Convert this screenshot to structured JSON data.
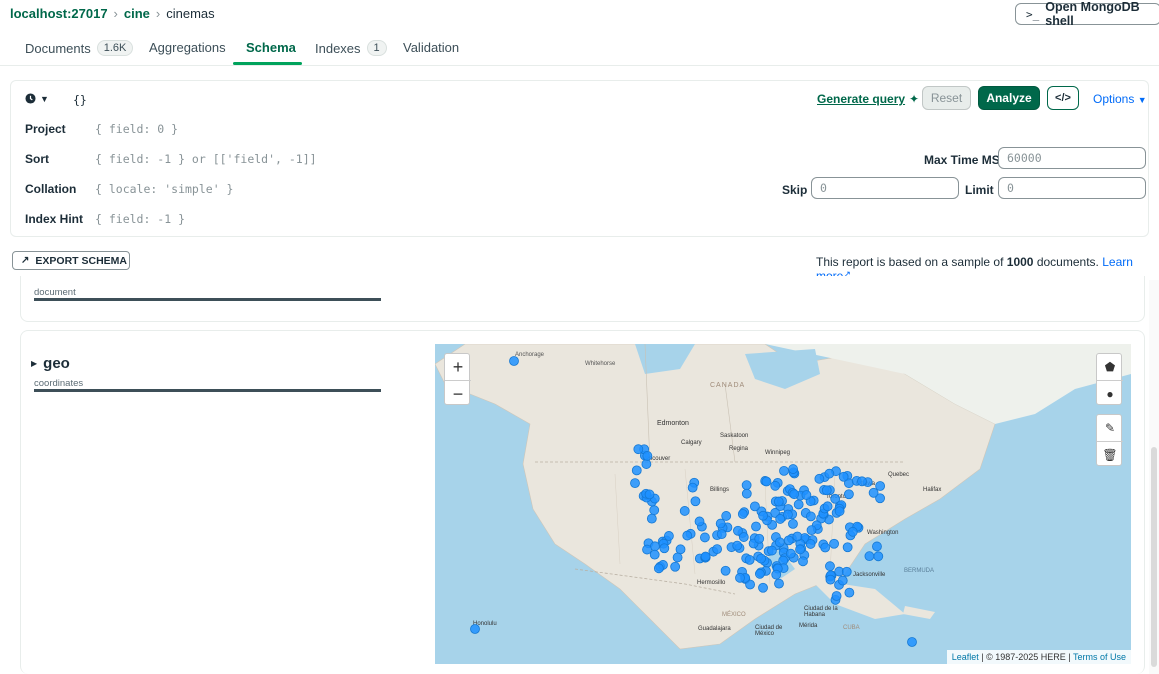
{
  "breadcrumb": {
    "host": "localhost:27017",
    "db": "cine",
    "collection": "cinemas"
  },
  "shell_button": {
    "prompt": ">_",
    "label": "Open MongoDB shell"
  },
  "tabs": [
    {
      "label": "Documents",
      "badge": "1.6K"
    },
    {
      "label": "Aggregations"
    },
    {
      "label": "Schema"
    },
    {
      "label": "Indexes",
      "badge": "1"
    },
    {
      "label": "Validation"
    }
  ],
  "query": {
    "filter_value": "{}",
    "generate_query": "Generate query",
    "reset": "Reset",
    "analyze": "Analyze",
    "code_toggle": "</>",
    "options": "Options",
    "project_label": "Project",
    "project_placeholder": "{ field: 0 }",
    "sort_label": "Sort",
    "sort_placeholder": "{ field: -1 } or [['field', -1]]",
    "collation_label": "Collation",
    "collation_placeholder": "{ locale: 'simple' }",
    "index_hint_label": "Index Hint",
    "index_hint_placeholder": "{ field: -1 }",
    "max_time_label": "Max Time MS",
    "max_time_placeholder": "60000",
    "skip_label": "Skip",
    "skip_placeholder": "0",
    "limit_label": "Limit",
    "limit_placeholder": "0"
  },
  "export": {
    "label": "EXPORT SCHEMA"
  },
  "report": {
    "prefix": "This report is based on a sample of",
    "count": "1000",
    "suffix": "documents.",
    "learn_more": "Learn more"
  },
  "fields": [
    {
      "type": "document"
    },
    {
      "name": "geo",
      "type": "coordinates"
    }
  ],
  "map": {
    "zoom_in": "+",
    "zoom_out": "−",
    "attribution_leaflet": "Leaflet",
    "attribution_text": "| © 1987-2025 HERE |",
    "attribution_terms": "Terms of Use",
    "marker_color": "#1e90ff",
    "labels": [
      {
        "text": "Anchorage"
      },
      {
        "text": "Whitehorse"
      },
      {
        "text": "CANADA"
      },
      {
        "text": "Edmonton"
      },
      {
        "text": "Calgary"
      },
      {
        "text": "Saskatoon"
      },
      {
        "text": "Regina"
      },
      {
        "text": "Winnipeg"
      },
      {
        "text": "Vancouver"
      },
      {
        "text": "Ottawa"
      },
      {
        "text": "Quebec"
      },
      {
        "text": "Halifax"
      },
      {
        "text": "Toronto"
      },
      {
        "text": "Washington"
      },
      {
        "text": "Jacksonville"
      },
      {
        "text": "Hermosillo"
      },
      {
        "text": "Ciudad de la Habana"
      },
      {
        "text": "Guadalajara"
      },
      {
        "text": "Ciudad de México"
      },
      {
        "text": "Mérida"
      },
      {
        "text": "CUBA"
      },
      {
        "text": "BERMUDA"
      },
      {
        "text": "Honolulu"
      },
      {
        "text": "MÉXICO"
      },
      {
        "text": "Billings"
      }
    ]
  }
}
